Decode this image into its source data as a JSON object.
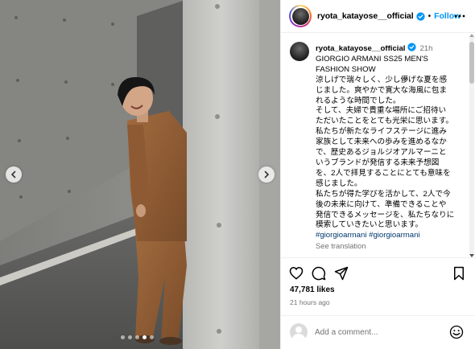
{
  "post": {
    "author": "ryota_katayose__official",
    "follow_label": "Follow",
    "separator": "•",
    "caption": {
      "time": "21h",
      "lines": [
        "GIORGIO ARMANI SS25 MEN'S",
        "FASHION SHOW",
        "涼しげで瑞々しく、少し儚げな夏を感",
        "じました。爽やかで寛大な海風に包ま",
        "れるような時間でした。",
        "そして、夫婦で貴重な場所にご招待い",
        "ただいたことをとても光栄に思います。",
        "私たちが新たなライフステージに進み",
        "家族として未来への歩みを進めるなか",
        "で、歴史あるジョルジオアルマーニと",
        "いうブランドが発信する未来予想図",
        "を、2人で拝見することにとても意味を",
        "感じました。",
        "私たちが得た学びを活かして、2人で今",
        "後の未来に向けて、準備できることや",
        "発信できるメッセージを、私たちなりに",
        "模索していきたいと思います。"
      ],
      "hashtags": "#giorgioarmani #giorgioarmani",
      "see_translation": "See translation"
    },
    "likes": "47,781 likes",
    "posted": "21 hours ago",
    "comment_placeholder": "Add a comment..."
  },
  "carousel": {
    "total": 5,
    "active_index": 3
  },
  "icons": {
    "verified": "verified-badge-icon",
    "more": "more-options-icon",
    "like": "heart-icon",
    "comment": "comment-icon",
    "share": "share-icon",
    "save": "bookmark-icon",
    "emoji": "emoji-icon",
    "prev": "chevron-left-icon",
    "next": "chevron-right-icon"
  },
  "colors": {
    "accent": "#0095f6",
    "muted": "#737373",
    "hashtag": "#00376b"
  }
}
